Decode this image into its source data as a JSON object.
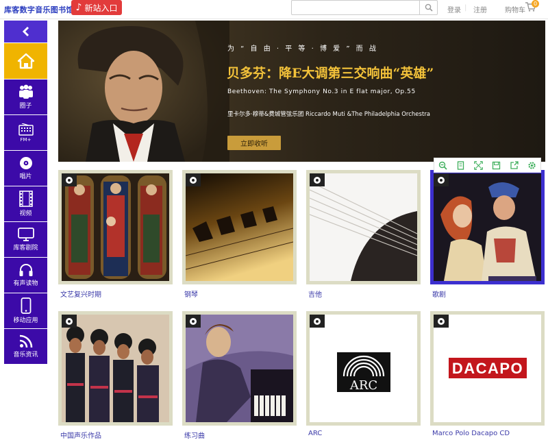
{
  "header": {
    "site_title": "库客数字音乐图书馆",
    "new_entry_label": "新站入口",
    "search_placeholder": "",
    "login_label": "登录",
    "register_label": "注册",
    "cart_label": "购物车",
    "cart_count": "0"
  },
  "sidebar": {
    "back_icon": "chevron-left-icon",
    "home_icon": "home-icon",
    "items": [
      {
        "label": "圈子",
        "icon": "group-icon"
      },
      {
        "label": "",
        "sublabel": "FM+",
        "icon": "radio-icon"
      },
      {
        "label": "唱片",
        "icon": "disc-icon"
      },
      {
        "label": "视频",
        "icon": "film-icon"
      },
      {
        "label": "库客剧院",
        "icon": "monitor-icon"
      },
      {
        "label": "有声读物",
        "icon": "headphones-icon"
      },
      {
        "label": "移动应用",
        "icon": "phone-icon"
      },
      {
        "label": "音乐资讯",
        "icon": "rss-icon"
      }
    ]
  },
  "banner": {
    "tagline": "为 “ 自 由 · 平 等 · 博 爱 ” 而 战",
    "title": "贝多芬：降E大调第三交响曲“英雄”",
    "english_title": "Beethoven: The Symphony No.3 in E flat major, Op.55",
    "performer": "里卡尔多·穆蒂&费城管弦乐团  Riccardo Muti &The Philadelphia Orchestra",
    "button_label": "立即收听"
  },
  "card_toolbar": {
    "icons": [
      "zoom-icon",
      "page-icon",
      "fullscreen-icon",
      "save-icon",
      "share-icon",
      "settings-icon"
    ]
  },
  "categories": [
    {
      "label": "文艺复兴时期"
    },
    {
      "label": "钢琴"
    },
    {
      "label": "吉他"
    },
    {
      "label": "歌剧"
    },
    {
      "label": "中国声乐作品"
    },
    {
      "label": "练习曲"
    },
    {
      "label": "ARC",
      "logo_text": "ARC"
    },
    {
      "label": "Marco Polo Dacapo CD",
      "logo_text": "DACAPO"
    }
  ],
  "colors": {
    "sidebar_bg": "#3c0aa8",
    "home_bg": "#f0b400",
    "banner_gold": "#f3c23a",
    "accent_red": "#e23b3b",
    "active_border": "#3c2fcf"
  }
}
